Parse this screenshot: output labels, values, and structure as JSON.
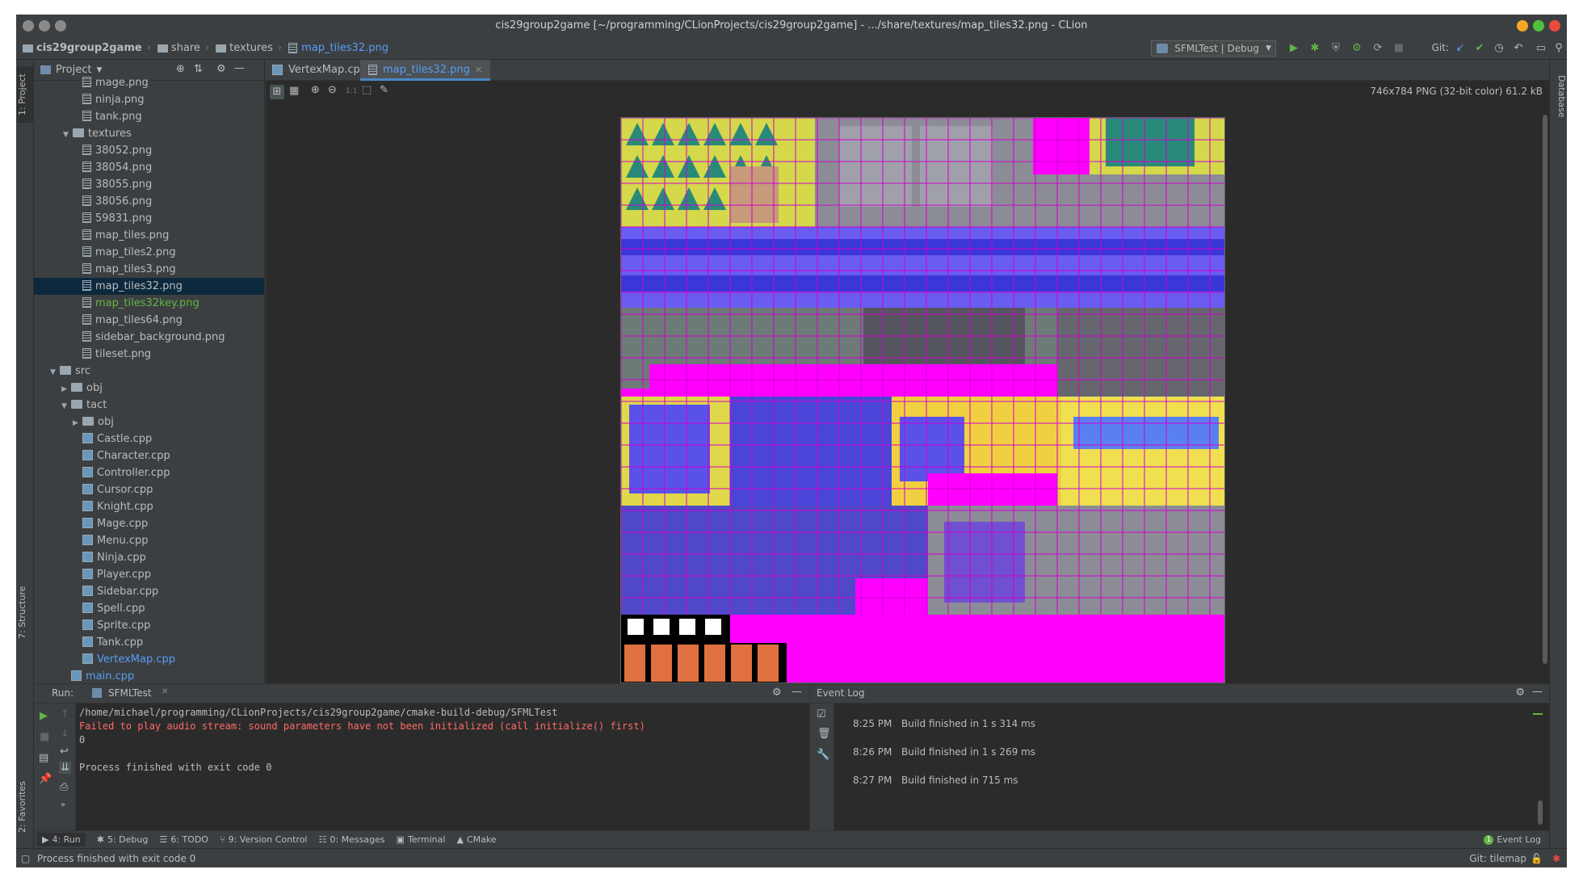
{
  "window": {
    "title": "cis29group2game [~/programming/CLionProjects/cis29group2game] - .../share/textures/map_tiles32.png - CLion"
  },
  "breadcrumb": [
    "cis29group2game",
    "share",
    "textures",
    "map_tiles32.png"
  ],
  "toolbar": {
    "run_config": "SFMLTest | Debug",
    "git_label": "Git:"
  },
  "sidebar": {
    "left_tabs": [
      "1: Project",
      "7: Structure",
      "2: Favorites"
    ],
    "right_tabs": [
      "Database"
    ],
    "project_header": "Project",
    "tree": [
      {
        "label": "mage.png",
        "kind": "png"
      },
      {
        "label": "ninja.png",
        "kind": "png"
      },
      {
        "label": "tank.png",
        "kind": "png"
      },
      {
        "label": "textures",
        "kind": "folder-open"
      },
      {
        "label": "38052.png",
        "kind": "png"
      },
      {
        "label": "38054.png",
        "kind": "png"
      },
      {
        "label": "38055.png",
        "kind": "png"
      },
      {
        "label": "38056.png",
        "kind": "png"
      },
      {
        "label": "59831.png",
        "kind": "png"
      },
      {
        "label": "map_tiles.png",
        "kind": "png"
      },
      {
        "label": "map_tiles2.png",
        "kind": "png"
      },
      {
        "label": "map_tiles3.png",
        "kind": "png"
      },
      {
        "label": "map_tiles32.png",
        "kind": "png",
        "selected": true
      },
      {
        "label": "map_tiles32key.png",
        "kind": "png",
        "color": "green"
      },
      {
        "label": "map_tiles64.png",
        "kind": "png"
      },
      {
        "label": "sidebar_background.png",
        "kind": "png"
      },
      {
        "label": "tileset.png",
        "kind": "png"
      },
      {
        "label": "src",
        "kind": "folder-open"
      },
      {
        "label": "obj",
        "kind": "folder-closed"
      },
      {
        "label": "tact",
        "kind": "folder-open"
      },
      {
        "label": "obj",
        "kind": "folder-closed"
      },
      {
        "label": "Castle.cpp",
        "kind": "cpp"
      },
      {
        "label": "Character.cpp",
        "kind": "cpp"
      },
      {
        "label": "Controller.cpp",
        "kind": "cpp"
      },
      {
        "label": "Cursor.cpp",
        "kind": "cpp"
      },
      {
        "label": "Knight.cpp",
        "kind": "cpp"
      },
      {
        "label": "Mage.cpp",
        "kind": "cpp"
      },
      {
        "label": "Menu.cpp",
        "kind": "cpp"
      },
      {
        "label": "Ninja.cpp",
        "kind": "cpp"
      },
      {
        "label": "Player.cpp",
        "kind": "cpp"
      },
      {
        "label": "Sidebar.cpp",
        "kind": "cpp"
      },
      {
        "label": "Spell.cpp",
        "kind": "cpp"
      },
      {
        "label": "Sprite.cpp",
        "kind": "cpp"
      },
      {
        "label": "Tank.cpp",
        "kind": "cpp"
      },
      {
        "label": "VertexMap.cpp",
        "kind": "cpp",
        "color": "blue"
      },
      {
        "label": "main.cpp",
        "kind": "cpp",
        "color": "blue"
      }
    ]
  },
  "editor": {
    "tabs": [
      {
        "label": "VertexMap.cpp",
        "active": false
      },
      {
        "label": "map_tiles32.png",
        "active": true
      }
    ],
    "zoom_label": "1:1",
    "image_info": "746x784 PNG (32-bit color) 61.2 kB"
  },
  "run_panel": {
    "title": "Run:",
    "tab": "SFMLTest",
    "lines": [
      {
        "text": "/home/michael/programming/CLionProjects/cis29group2game/cmake-build-debug/SFMLTest",
        "color": "#bbbbbb"
      },
      {
        "text": "Failed to play audio stream: sound parameters have not been initialized (call initialize() first)",
        "color": "#ff6b68"
      },
      {
        "text": "0",
        "color": "#bbbbbb"
      },
      {
        "text": "",
        "color": "#bbbbbb"
      },
      {
        "text": "Process finished with exit code 0",
        "color": "#bbbbbb"
      }
    ]
  },
  "event_log": {
    "title": "Event Log",
    "entries": [
      {
        "time": "8:25 PM",
        "message": "Build finished in 1 s 314 ms"
      },
      {
        "time": "8:26 PM",
        "message": "Build finished in 1 s 269 ms"
      },
      {
        "time": "8:27 PM",
        "message": "Build finished in 715 ms"
      }
    ]
  },
  "tool_windows": [
    {
      "num": "4",
      "label": "4: Run"
    },
    {
      "num": "5",
      "label": "5: Debug"
    },
    {
      "num": "6",
      "label": "6: TODO"
    },
    {
      "num": "9",
      "label": "9: Version Control"
    },
    {
      "num": "0",
      "label": "0: Messages"
    },
    {
      "num": "",
      "label": "Terminal"
    },
    {
      "num": "",
      "label": "CMake"
    }
  ],
  "event_log_badge": "1",
  "event_log_button": "Event Log",
  "status": {
    "message": "Process finished with exit code 0",
    "git": "Git: tilemap"
  },
  "colors": {
    "accent": "#4a88c7",
    "error_text": "#ff6b68",
    "green": "#62b543",
    "magenta": "#ff00ff"
  }
}
